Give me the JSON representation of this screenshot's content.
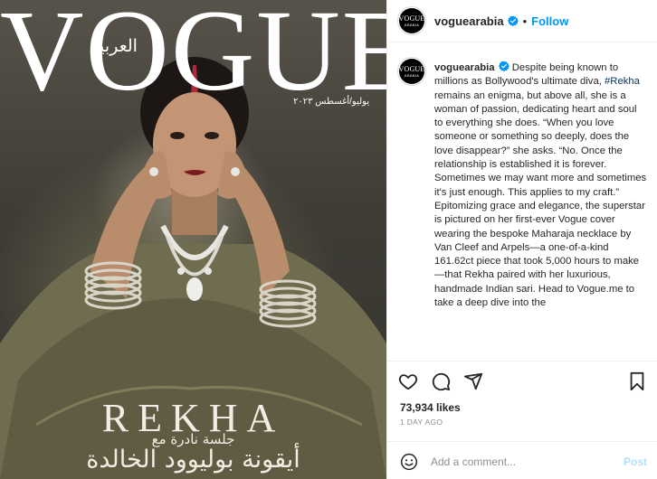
{
  "cover": {
    "logo": "VOGUE",
    "arabic_brand": "العربية",
    "issue_date": "يوليو/أغسطس ٢٠٢٣",
    "name": "REKHA",
    "arabic_line1": "جلسة نادرة مع",
    "arabic_line2": "أيقونة بوليوود الخالدة"
  },
  "header": {
    "avatar_line1": "VOGUE",
    "avatar_line2": "ARABIA",
    "username": "voguearabia",
    "separator": "•",
    "follow_label": "Follow"
  },
  "caption": {
    "username": "voguearabia",
    "text_before": " Despite being known to millions as Bollywood's ultimate diva, ",
    "hashtag": "#Rekha",
    "text_after": " remains an enigma, but above all, she is a woman of passion, dedicating heart and soul to everything she does. “When you love someone or something so deeply, does the love disappear?” she asks. “No. Once the relationship is established it is forever. Sometimes we may want more and sometimes it's just enough. This applies to my craft.” Epitomizing grace and elegance, the superstar is pictured on her first-ever Vogue cover wearing the bespoke Maharaja necklace by Van Cleef and Arpels—a one-of-a-kind 161.62ct piece that took 5,000 hours to make—that Rekha paired with her luxurious, handmade Indian sari. Head to Vogue.me to take a deep dive into the"
  },
  "engagement": {
    "likes": "73,934 likes",
    "time_ago": "1 DAY AGO"
  },
  "comment": {
    "placeholder": "Add a comment...",
    "post_label": "Post"
  },
  "icons": [
    "verified-badge-icon",
    "heart-icon",
    "comment-icon",
    "share-icon",
    "bookmark-icon",
    "emoji-icon"
  ],
  "colors": {
    "link": "#0095f6",
    "hashtag": "#00376b",
    "muted": "#8e8e8e",
    "post_disabled": "#b3dffc",
    "verified": "#0095f6"
  }
}
